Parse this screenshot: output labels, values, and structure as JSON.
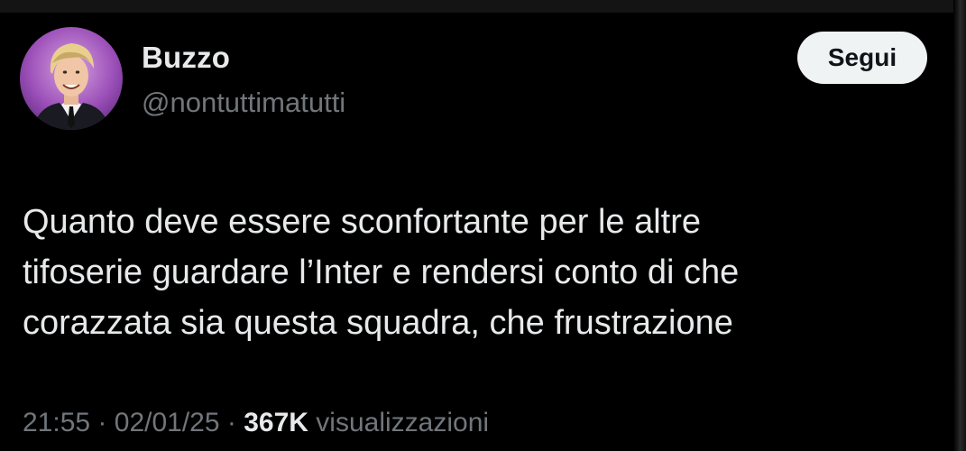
{
  "colors": {
    "background": "#000000",
    "text_primary": "#e7e9ea",
    "text_secondary": "#71767b",
    "follow_bg": "#eff3f4",
    "follow_text": "#0f1419"
  },
  "author": {
    "display_name": "Buzzo",
    "handle": "@nontuttimatutti",
    "avatar_icon": "profile-photo"
  },
  "follow_button": {
    "label": "Segui"
  },
  "tweet": {
    "lines": [
      "Quanto deve essere sconfortante per le altre",
      "tifoserie guardare l’Inter e rendersi conto di che",
      "corazzata sia questa squadra, che frustrazione"
    ]
  },
  "meta": {
    "time": "21:55",
    "separator": "·",
    "date": "02/01/25",
    "views_count": "367K",
    "views_label": "visualizzazioni"
  }
}
